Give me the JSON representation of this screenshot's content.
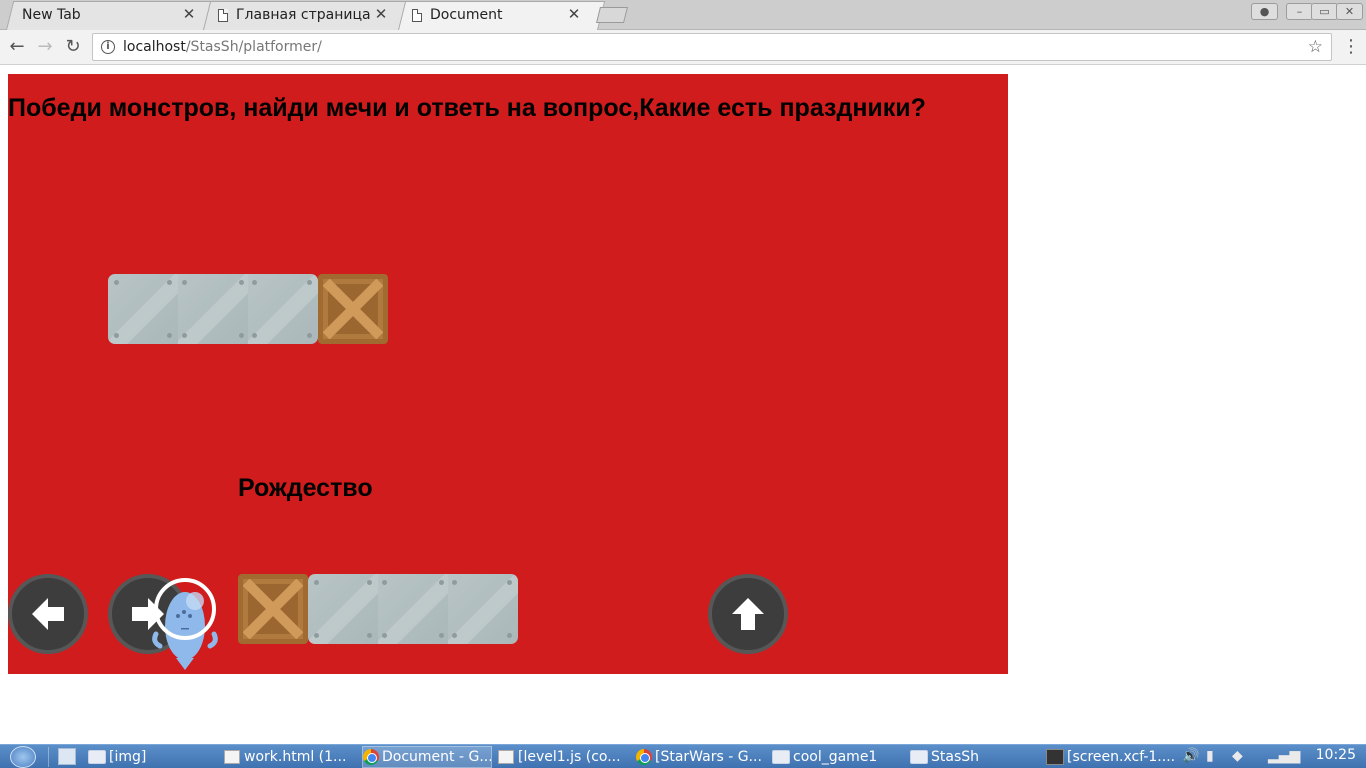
{
  "browser": {
    "tabs": [
      {
        "title": "New Tab",
        "active": false
      },
      {
        "title": "Главная страница",
        "active": false
      },
      {
        "title": "Document",
        "active": true
      }
    ],
    "url_host": "localhost",
    "url_path": "/StasSh/platformer/"
  },
  "game": {
    "question": "Победи монстров, найди мечи и ответь на вопрос,Какие есть праздники?",
    "answer": "Рождество",
    "background_color": "#d01c1c"
  },
  "controls": {
    "left_icon": "arrow-left-icon",
    "right_icon": "arrow-right-icon",
    "jump_icon": "arrow-up-icon"
  },
  "taskbar": {
    "items": [
      {
        "label": "[img]",
        "icon": "folder-icon"
      },
      {
        "label": "work.html (1...",
        "icon": "document-icon"
      },
      {
        "label": "Document - G...",
        "icon": "chrome-icon",
        "active": true
      },
      {
        "label": "[level1.js (co...",
        "icon": "document-icon"
      },
      {
        "label": "[StarWars - G...",
        "icon": "chrome-icon"
      },
      {
        "label": "cool_game1",
        "icon": "folder-icon"
      },
      {
        "label": "StasSh",
        "icon": "folder-icon"
      },
      {
        "label": "[screen.xcf-1....",
        "icon": "gimp-icon"
      }
    ],
    "clock": "10:25"
  }
}
